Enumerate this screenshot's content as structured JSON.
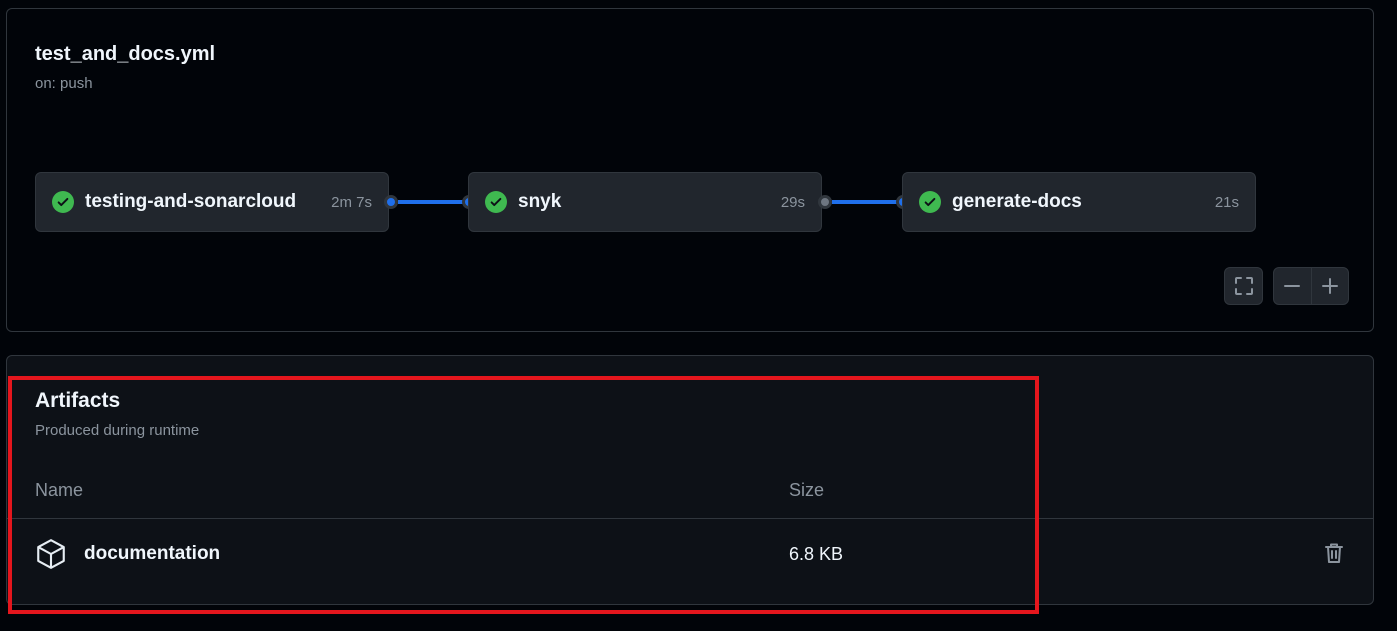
{
  "workflow": {
    "title": "test_and_docs.yml",
    "trigger": "on: push",
    "jobs": [
      {
        "name": "testing-and-sonarcloud",
        "duration": "2m 7s",
        "status": "success"
      },
      {
        "name": "snyk",
        "duration": "29s",
        "status": "success"
      },
      {
        "name": "generate-docs",
        "duration": "21s",
        "status": "success"
      }
    ],
    "controls": {
      "fullscreen_icon": "fullscreen-icon",
      "zoom_out_icon": "minus-icon",
      "zoom_in_icon": "plus-icon"
    }
  },
  "artifacts": {
    "title": "Artifacts",
    "subtitle": "Produced during runtime",
    "columns": {
      "name": "Name",
      "size": "Size"
    },
    "items": [
      {
        "name": "documentation",
        "size": "6.8 KB",
        "icon": "package-icon",
        "action_icon": "trash-icon"
      }
    ]
  },
  "colors": {
    "success": "#3fb950",
    "accent": "#1f6feb",
    "highlight": "#e4161d",
    "background": "#010409",
    "panel": "#0d1117",
    "job_card": "#21262d"
  }
}
